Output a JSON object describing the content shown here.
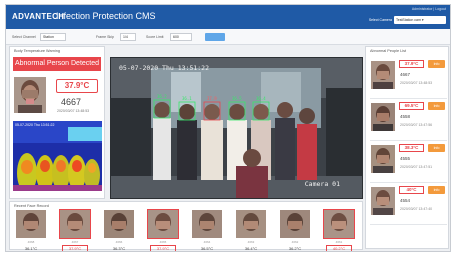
{
  "header": {
    "logo": "ADVANTECH",
    "app_title": "Infection Protection CMS",
    "user_text": "Administrator | Logout",
    "select_label": "Select Camera",
    "select_value": "TestStation cam ▾"
  },
  "filters": {
    "select_channel_label": "Select Channel",
    "select_channel_value": "Station",
    "frame_label": "Frame Skip",
    "frame_value": "1/4",
    "score_label": "Score Limit",
    "score_value": "600"
  },
  "left_panel": {
    "title": "Body Temperature Warning",
    "alert_text": "Abnormal Person Detected",
    "temperature": "37.9°C",
    "person_id": "4667",
    "time": "2020/03/07 13:48:53",
    "thermal_timestamp": "05-07-2020 Thu 13:51:22"
  },
  "camera": {
    "timestamp": "05-07-2020 Thu 13:51:22",
    "name": "Camera 01",
    "tags": [
      "36.2",
      "36.1",
      "37.9",
      "36.5",
      "36.4"
    ]
  },
  "right_panel": {
    "title": "Abnormal People List",
    "items": [
      {
        "temp": "37.9°C",
        "button": "Info",
        "id": "4667",
        "time": "2020/03/07 13:48:53"
      },
      {
        "temp": "69.5°C",
        "button": "Info",
        "id": "4558",
        "time": "2020/03/07 13:47:56"
      },
      {
        "temp": "38.3°C",
        "button": "Info",
        "id": "4555",
        "time": "2020/03/07 13:47:51"
      },
      {
        "temp": "40°C",
        "button": "Info",
        "id": "4554",
        "time": "2020/03/07 13:47:40"
      }
    ]
  },
  "bottom_panel": {
    "title": "Recent Face Record",
    "thumbs": [
      {
        "id": "4668",
        "temp": "36.1°C",
        "alert": false
      },
      {
        "id": "4667",
        "temp": "37.9°C",
        "alert": true
      },
      {
        "id": "4666",
        "temp": "36.3°C",
        "alert": false
      },
      {
        "id": "4665",
        "temp": "37.9°C",
        "alert": true
      },
      {
        "id": "4664",
        "temp": "36.5°C",
        "alert": false
      },
      {
        "id": "4663",
        "temp": "36.4°C",
        "alert": false
      },
      {
        "id": "4662",
        "temp": "36.2°C",
        "alert": false
      },
      {
        "id": "4661",
        "temp": "40.2°C",
        "alert": true
      }
    ]
  },
  "colors": {
    "header": "#1f5aa6",
    "alert": "#e8464b",
    "info_button": "#f39a3c",
    "apply_button": "#5fa6e8"
  }
}
